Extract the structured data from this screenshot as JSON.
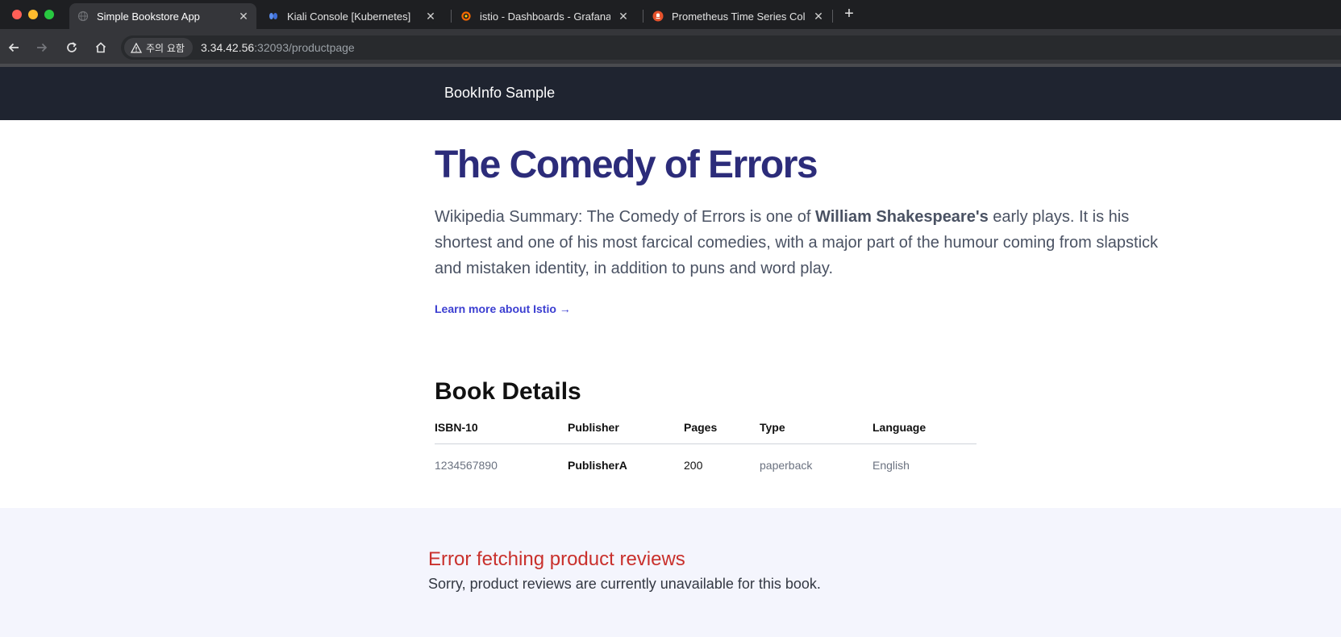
{
  "browser": {
    "tabs": [
      {
        "title": "Simple Bookstore App",
        "active": true,
        "icon": "globe-icon"
      },
      {
        "title": "Kiali Console [Kubernetes]",
        "active": false,
        "icon": "kiali-icon"
      },
      {
        "title": "istio - Dashboards - Grafana",
        "active": false,
        "icon": "grafana-icon"
      },
      {
        "title": "Prometheus Time Series Colle",
        "active": false,
        "icon": "prometheus-icon"
      }
    ],
    "security_label": "주의 요함",
    "url_host": "3.34.42.56",
    "url_path": ":32093/productpage"
  },
  "header": {
    "site_title": "BookInfo Sample"
  },
  "product": {
    "title": "The Comedy of Errors",
    "summary_prefix": "Wikipedia Summary: The Comedy of Errors is one of ",
    "summary_author": "William Shakespeare's",
    "summary_suffix": " early plays. It is his shortest and one of his most farcical comedies, with a major part of the humour coming from slapstick and mistaken identity, in addition to puns and word play.",
    "learn_more": "Learn more about Istio →"
  },
  "details": {
    "title": "Book Details",
    "columns": [
      "ISBN-10",
      "Publisher",
      "Pages",
      "Type",
      "Language"
    ],
    "row": {
      "isbn": "1234567890",
      "publisher": "PublisherA",
      "pages": "200",
      "type": "paperback",
      "language": "English"
    }
  },
  "reviews": {
    "error_title": "Error fetching product reviews",
    "error_message": "Sorry, product reviews are currently unavailable for this book."
  },
  "colors": {
    "header_bg": "#1f2430",
    "title_color": "#2c2c7a",
    "link_color": "#3b3ed1",
    "error_color": "#c9302c",
    "reviews_bg": "#f4f5fd"
  }
}
